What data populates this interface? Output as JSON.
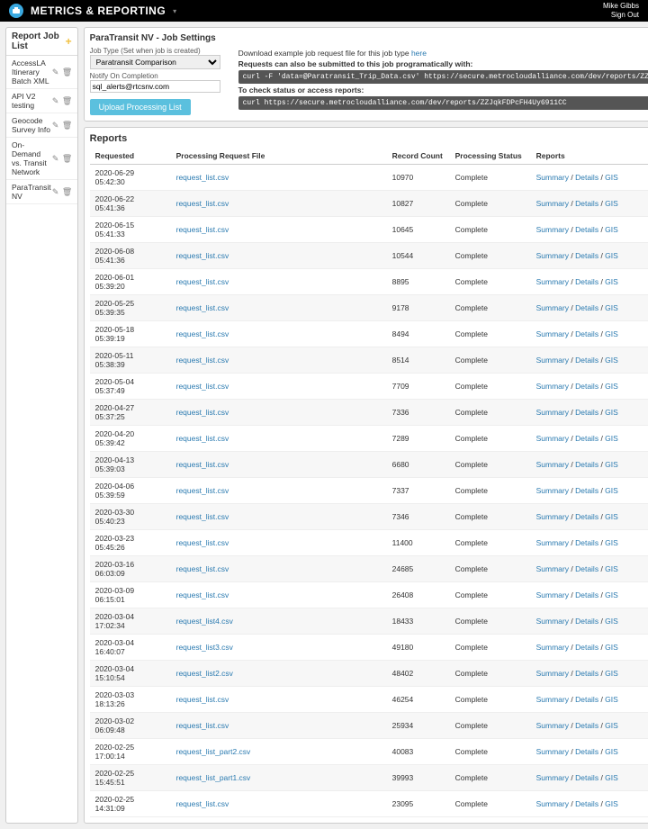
{
  "topbar": {
    "brand": "Metrics & Reporting",
    "user": "Mike Gibbs",
    "signout": "Sign Out"
  },
  "sidebar": {
    "title": "Report Job List",
    "items": [
      {
        "label": "AccessLA Itinerary Batch XML"
      },
      {
        "label": "API V2 testing"
      },
      {
        "label": "Geocode Survey Info"
      },
      {
        "label": "On-Demand vs. Transit Network"
      },
      {
        "label": "ParaTransit NV"
      }
    ]
  },
  "settings": {
    "title": "ParaTransit NV - Job Settings",
    "job_type_label": "Job Type (Set when job is created)",
    "job_type_value": "Paratransit Comparison",
    "notify_label": "Notify On Completion",
    "notify_value": "sql_alerts@rtcsnv.com",
    "upload_btn": "Upload Processing List",
    "download_text": "Download example job request file for this job type ",
    "download_link": "here",
    "prog_text": "Requests can also be submitted to this job programatically with:",
    "curl1": "curl -F 'data=@Paratransit_Trip_Data.csv' https://secure.metrocloudalliance.com/dev/reports/ZZJqkFDPcFH",
    "check_text": "To check status or access reports:",
    "curl2": "curl https://secure.metrocloudalliance.com/dev/reports/ZZJqkFDPcFH4Uy6911CC"
  },
  "reports": {
    "title": "Reports",
    "headers": {
      "requested": "Requested",
      "file": "Processing Request File",
      "count": "Record Count",
      "status": "Processing Status",
      "reports": "Reports"
    },
    "link_summary": "Summary",
    "link_details": "Details",
    "link_gis": "GIS",
    "rows": [
      {
        "requested": "2020-06-29 05:42:30",
        "file": "request_list.csv",
        "count": "10970",
        "status": "Complete"
      },
      {
        "requested": "2020-06-22 05:41:36",
        "file": "request_list.csv",
        "count": "10827",
        "status": "Complete"
      },
      {
        "requested": "2020-06-15 05:41:33",
        "file": "request_list.csv",
        "count": "10645",
        "status": "Complete"
      },
      {
        "requested": "2020-06-08 05:41:36",
        "file": "request_list.csv",
        "count": "10544",
        "status": "Complete"
      },
      {
        "requested": "2020-06-01 05:39:20",
        "file": "request_list.csv",
        "count": "8895",
        "status": "Complete"
      },
      {
        "requested": "2020-05-25 05:39:35",
        "file": "request_list.csv",
        "count": "9178",
        "status": "Complete"
      },
      {
        "requested": "2020-05-18 05:39:19",
        "file": "request_list.csv",
        "count": "8494",
        "status": "Complete"
      },
      {
        "requested": "2020-05-11 05:38:39",
        "file": "request_list.csv",
        "count": "8514",
        "status": "Complete"
      },
      {
        "requested": "2020-05-04 05:37:49",
        "file": "request_list.csv",
        "count": "7709",
        "status": "Complete"
      },
      {
        "requested": "2020-04-27 05:37:25",
        "file": "request_list.csv",
        "count": "7336",
        "status": "Complete"
      },
      {
        "requested": "2020-04-20 05:39:42",
        "file": "request_list.csv",
        "count": "7289",
        "status": "Complete"
      },
      {
        "requested": "2020-04-13 05:39:03",
        "file": "request_list.csv",
        "count": "6680",
        "status": "Complete"
      },
      {
        "requested": "2020-04-06 05:39:59",
        "file": "request_list.csv",
        "count": "7337",
        "status": "Complete"
      },
      {
        "requested": "2020-03-30 05:40:23",
        "file": "request_list.csv",
        "count": "7346",
        "status": "Complete"
      },
      {
        "requested": "2020-03-23 05:45:26",
        "file": "request_list.csv",
        "count": "11400",
        "status": "Complete"
      },
      {
        "requested": "2020-03-16 06:03:09",
        "file": "request_list.csv",
        "count": "24685",
        "status": "Complete"
      },
      {
        "requested": "2020-03-09 06:15:01",
        "file": "request_list.csv",
        "count": "26408",
        "status": "Complete"
      },
      {
        "requested": "2020-03-04 17:02:34",
        "file": "request_list4.csv",
        "count": "18433",
        "status": "Complete"
      },
      {
        "requested": "2020-03-04 16:40:07",
        "file": "request_list3.csv",
        "count": "49180",
        "status": "Complete"
      },
      {
        "requested": "2020-03-04 15:10:54",
        "file": "request_list2.csv",
        "count": "48402",
        "status": "Complete"
      },
      {
        "requested": "2020-03-03 18:13:26",
        "file": "request_list.csv",
        "count": "46254",
        "status": "Complete"
      },
      {
        "requested": "2020-03-02 06:09:48",
        "file": "request_list.csv",
        "count": "25934",
        "status": "Complete"
      },
      {
        "requested": "2020-02-25 17:00:14",
        "file": "request_list_part2.csv",
        "count": "40083",
        "status": "Complete"
      },
      {
        "requested": "2020-02-25 15:45:51",
        "file": "request_list_part1.csv",
        "count": "39993",
        "status": "Complete"
      },
      {
        "requested": "2020-02-25 14:31:09",
        "file": "request_list.csv",
        "count": "23095",
        "status": "Complete"
      }
    ]
  }
}
